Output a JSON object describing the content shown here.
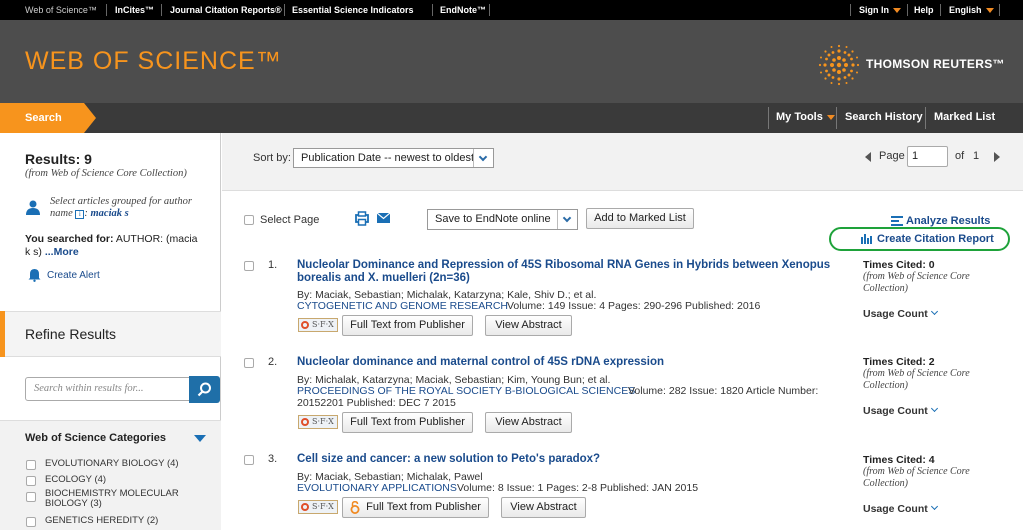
{
  "topnav": {
    "links": [
      "Web of Science™",
      "InCites™",
      "Journal Citation Reports®",
      "Essential Science Indicators",
      "EndNote™"
    ],
    "sign_in": "Sign In",
    "help": "Help",
    "language": "English"
  },
  "header": {
    "logo": "WEB OF SCIENCE™",
    "brand": "THOMSON REUTERS™"
  },
  "navbar": {
    "search_tab": "Search",
    "my_tools": "My Tools",
    "search_history": "Search History",
    "marked_list": "Marked List"
  },
  "sidebar": {
    "results_label": "Results: 9",
    "results_source": "(from Web of Science Core Collection)",
    "grouped_text": "Select articles grouped for author name",
    "grouped_author": "maciak s",
    "you_searched": "You searched for:",
    "search_query": "AUTHOR: (macia k s)",
    "more": "...More",
    "create_alert": "Create Alert",
    "refine_title": "Refine Results",
    "search_within_placeholder": "Search within results for...",
    "categories_title": "Web of Science Categories",
    "categories": [
      "EVOLUTIONARY BIOLOGY (4)",
      "ECOLOGY (4)",
      "BIOCHEMISTRY MOLECULAR BIOLOGY (3)",
      "GENETICS HEREDITY (2)"
    ]
  },
  "toolbar": {
    "sort_label": "Sort by:",
    "sort_value": "Publication Date -- newest to oldest",
    "page_label": "Page",
    "page_value": "1",
    "of_label": "of",
    "total_pages": "1",
    "select_page": "Select Page",
    "save_endnote": "Save to EndNote online",
    "add_marked": "Add to Marked List",
    "analyze": "Analyze Results",
    "citation_report": "Create Citation Report"
  },
  "results": [
    {
      "num": "1.",
      "title_1": "Nucleolar Dominance and Repression of 45S Ribosomal RNA Genes in Hybrids between Xenopus",
      "title_2": "borealis and X. muelleri (2n=36)",
      "authors": "By: Maciak, Sebastian; Michalak, Katarzyna; Kale, Shiv D.; et al.",
      "journal": "CYTOGENETIC AND GENOME RESEARCH",
      "meta": "Volume: 149   Issue: 4   Pages: 290-296   Published: 2016",
      "meta_2": "",
      "times_cited": "Times Cited: 0",
      "usage": "Usage Count"
    },
    {
      "num": "2.",
      "title_1": "Nucleolar dominance and maternal control of 45S rDNA expression",
      "title_2": "",
      "authors": "By: Michalak, Katarzyna; Maciak, Sebastian; Kim, Young Bun; et al.",
      "journal": "PROCEEDINGS OF THE ROYAL SOCIETY B-BIOLOGICAL SCIENCES",
      "meta": "Volume: 282   Issue: 1820   Article Number:",
      "meta_2": "20152201   Published: DEC 7 2015",
      "times_cited": "Times Cited: 2",
      "usage": "Usage Count"
    },
    {
      "num": "3.",
      "title_1": "Cell size and cancer: a new solution to Peto's paradox?",
      "title_2": "",
      "authors": "By: Maciak, Sebastian; Michalak, Pawel",
      "journal": "EVOLUTIONARY APPLICATIONS",
      "meta": "Volume: 8   Issue: 1   Pages: 2-8   Published: JAN 2015",
      "meta_2": "",
      "times_cited": "Times Cited: 4",
      "usage": "Usage Count"
    }
  ],
  "result_common": {
    "cited_source": "(from Web of Science Core Collection)",
    "full_text": "Full Text from Publisher",
    "view_abstract": "View Abstract",
    "sfx": "S·F·X"
  },
  "colors": {
    "accent": "#f7941d",
    "link": "#1a4b8c",
    "highlight": "#1ea23a"
  }
}
